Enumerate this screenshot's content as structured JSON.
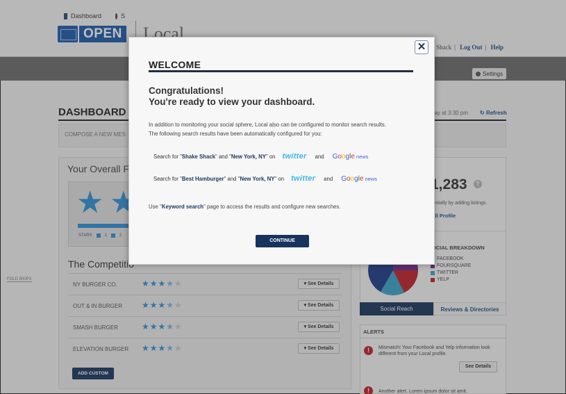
{
  "header": {
    "logo_text": "OPEN",
    "product": "Local",
    "links": [
      "ake Shack",
      "Log Out",
      "Help"
    ]
  },
  "nav": {
    "tabs": [
      {
        "label": "Dashboard",
        "icon": "dashboard-icon"
      },
      {
        "label": "S",
        "icon": "chat-icon"
      }
    ],
    "settings_label": "Settings"
  },
  "dashboard": {
    "title": "DASHBOARD",
    "updated": "day at 3:30 pm",
    "refresh_label": "Refresh",
    "compose_placeholder": "COMPOSE A NEW MES",
    "overall_title": "Your Overall F",
    "stars_legend": [
      "STARS",
      "1",
      "2"
    ]
  },
  "competition": {
    "title": "The Competitio",
    "rows": [
      {
        "name": "NY BURGER CO.",
        "stars": "★★★★★",
        "button": "▾ See Details"
      },
      {
        "name": "OUT & IN BURGER",
        "stars": "★★★★★",
        "button": "▾ See Details"
      },
      {
        "name": "SMASH BURGER",
        "stars": "★★★★★",
        "button": "▾ See Details"
      },
      {
        "name": "ELEVATION BURGER",
        "stars": "★★★★★",
        "button": "▾ See Details"
      }
    ],
    "add_custom": "ADD CUSTOM"
  },
  "fold_label": "FOLD 800PX",
  "social": {
    "count": "1,283",
    "help_icon": "?",
    "text1": "entially by adding listings.",
    "text2": "ull Profile",
    "breakdown_title": "OCIAL BREAKDOWN",
    "legend": [
      {
        "label": "FACEBOOK",
        "color": "#1c3a8a"
      },
      {
        "label": "FOURSQUARE",
        "color": "#6b2a8c"
      },
      {
        "label": "TWITTER",
        "color": "#38a3c9"
      },
      {
        "label": "YELP",
        "color": "#c0202a"
      }
    ],
    "tab_reach": "Social Reach",
    "tab_reviews": "Reviews & Directories"
  },
  "alerts": {
    "title": "ALERTS",
    "items": [
      {
        "text": "Mismatch! Your Facebook and Yelp information look different from your Local profile."
      },
      {
        "text": "Another alert. Lorem ipsum dolor sit amit."
      }
    ],
    "see_details": "See Details"
  },
  "modal": {
    "close_glyph": "✕",
    "title": "WELCOME",
    "congrats_line1": "Congratulations!",
    "congrats_line2": "You're ready to view your dashboard.",
    "body_line1": "In addition to monitoring your social sphere, Local also can be configured to monitor search results.",
    "body_line2": "The following search results have been automatically configured for you:",
    "searches": [
      {
        "prefix": "Search for \"",
        "term": "Shake Shack",
        "mid": "\" and \"",
        "location": "New York, NY",
        "suffix": "\"  on",
        "and": "and"
      },
      {
        "prefix": "Search for \"",
        "term": "Best Hamburger",
        "mid": "\" and \"",
        "location": "New York, NY",
        "suffix": "\"  on",
        "and": "and"
      }
    ],
    "twitter_word": "twitter",
    "google_letters": [
      "G",
      "o",
      "o",
      "g",
      "l",
      "e"
    ],
    "google_news": "news",
    "keyword_pre": "Use \"",
    "keyword_term": "Keyword search",
    "keyword_post": "\" page to access the results and configure new searches.",
    "continue_label": "CONTINUE"
  }
}
